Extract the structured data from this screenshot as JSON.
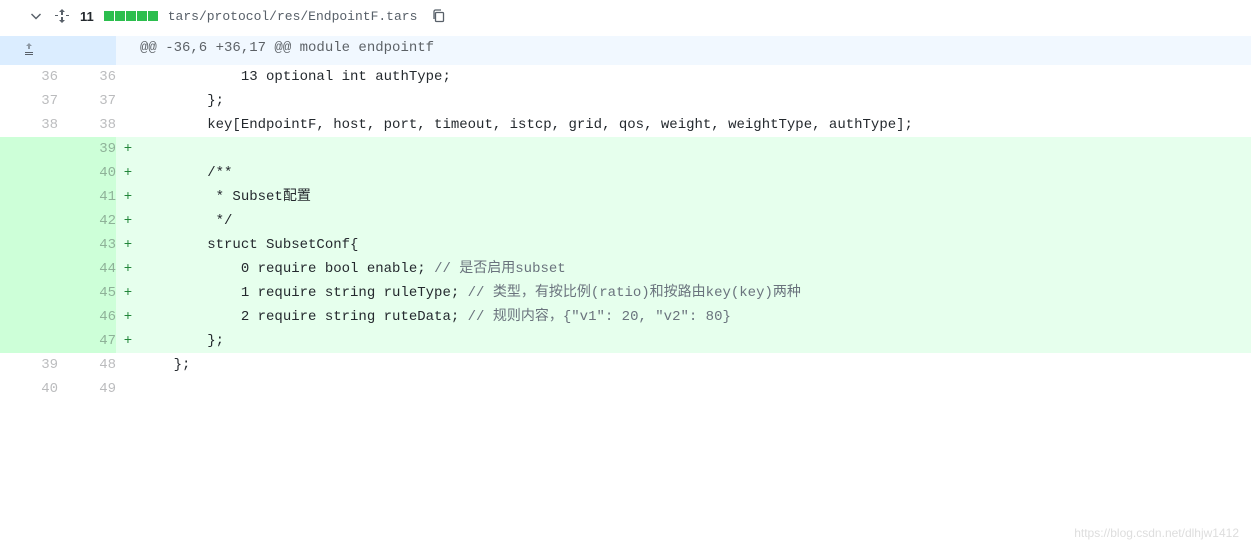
{
  "header": {
    "line_count": "11",
    "file_path": "tars/protocol/res/EndpointF.tars",
    "diff_block_count": 5
  },
  "hunk_header": "@@ -36,6 +36,17 @@ module endpointf",
  "lines": [
    {
      "old": "36",
      "new": "36",
      "type": "context",
      "code": "            13 optional int authType;"
    },
    {
      "old": "37",
      "new": "37",
      "type": "context",
      "code": "        };"
    },
    {
      "old": "38",
      "new": "38",
      "type": "context",
      "code": "        key[EndpointF, host, port, timeout, istcp, grid, qos, weight, weightType, authType];"
    },
    {
      "old": "",
      "new": "39",
      "type": "added",
      "code": ""
    },
    {
      "old": "",
      "new": "40",
      "type": "added",
      "code": "        /**"
    },
    {
      "old": "",
      "new": "41",
      "type": "added",
      "code": "         * Subset配置"
    },
    {
      "old": "",
      "new": "42",
      "type": "added",
      "code": "         */"
    },
    {
      "old": "",
      "new": "43",
      "type": "added",
      "code": "        struct SubsetConf{"
    },
    {
      "old": "",
      "new": "44",
      "type": "added",
      "code": "            0 require bool enable; ",
      "comment": "// 是否启用subset"
    },
    {
      "old": "",
      "new": "45",
      "type": "added",
      "code": "            1 require string ruleType; ",
      "comment": "// 类型，有按比例(ratio)和按路由key(key)两种"
    },
    {
      "old": "",
      "new": "46",
      "type": "added",
      "code": "            2 require string ruteData; ",
      "comment": "// 规则内容，{\"v1\": 20, \"v2\": 80}"
    },
    {
      "old": "",
      "new": "47",
      "type": "added",
      "code": "        };"
    },
    {
      "old": "39",
      "new": "48",
      "type": "context",
      "code": "    };"
    },
    {
      "old": "40",
      "new": "49",
      "type": "context",
      "code": ""
    }
  ],
  "watermark": "https://blog.csdn.net/dlhjw1412"
}
